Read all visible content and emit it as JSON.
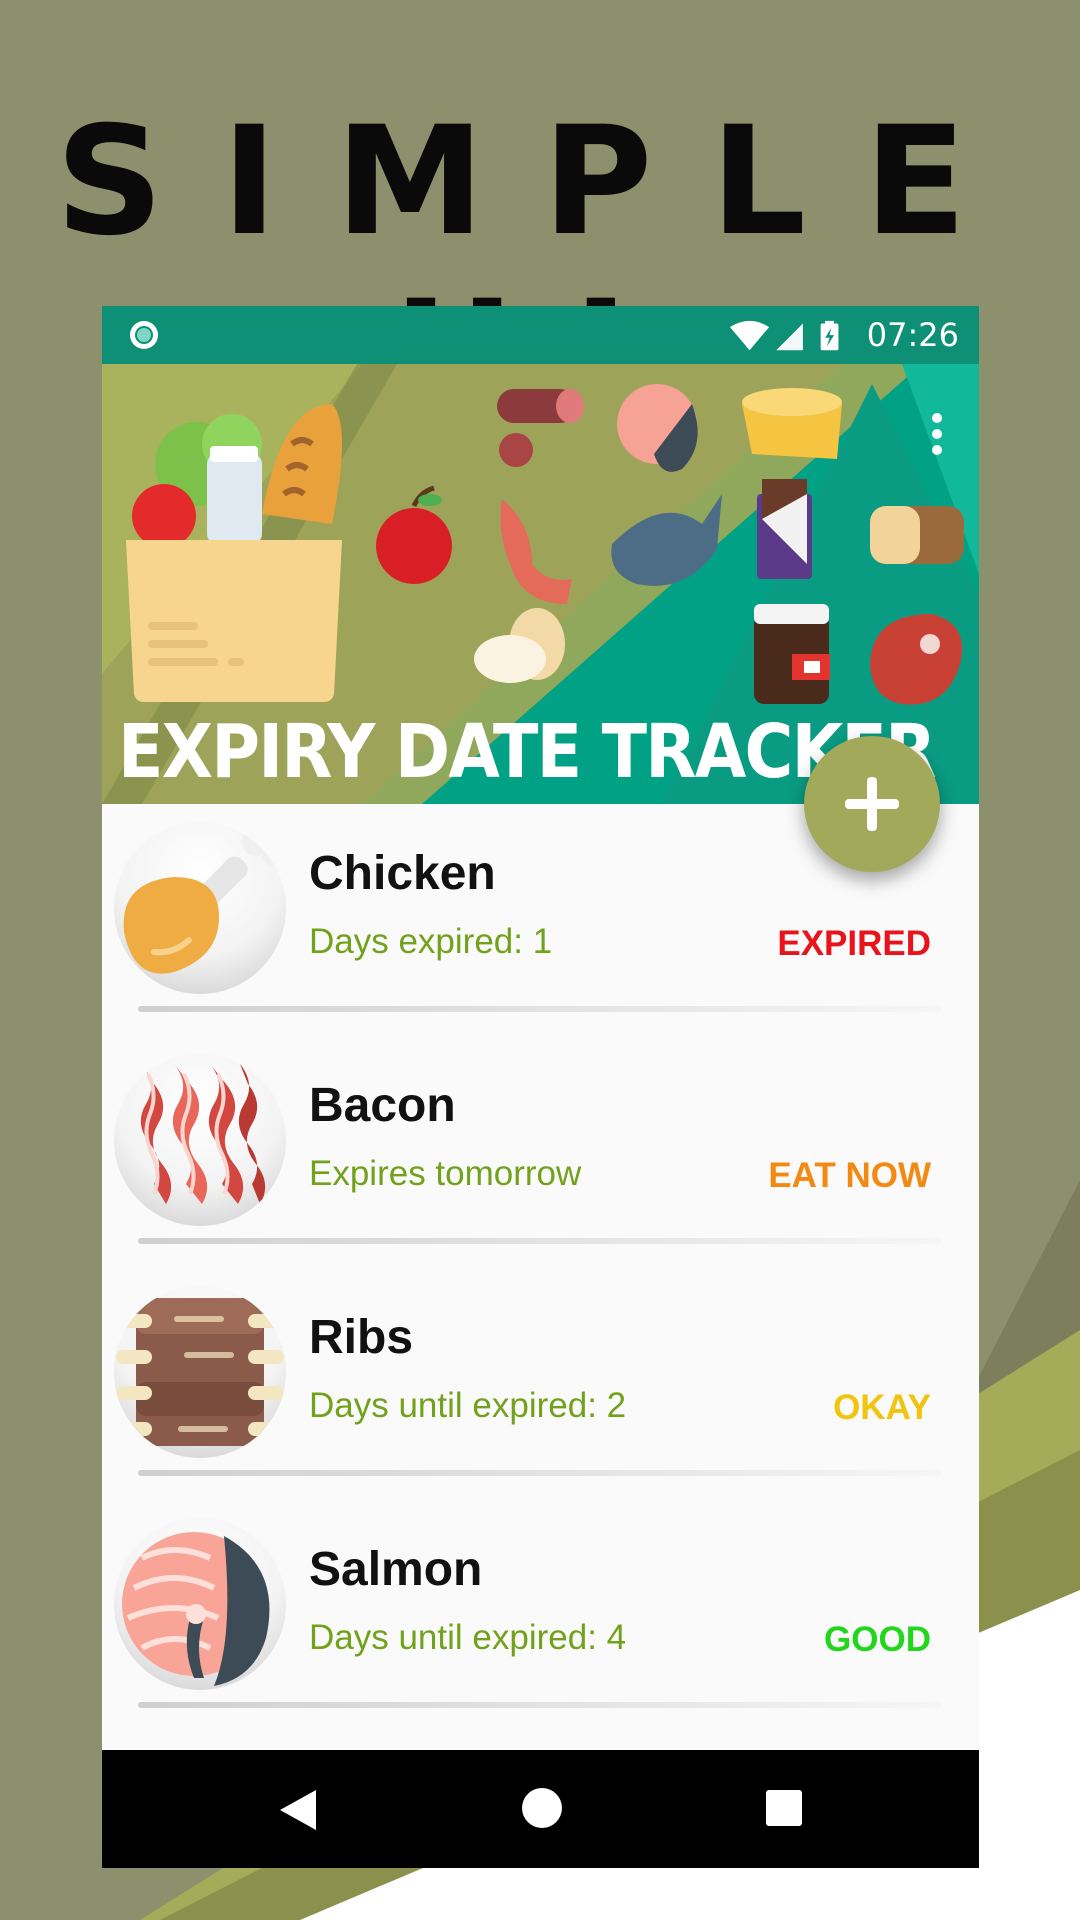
{
  "promo": {
    "title": "SIMPLE UI"
  },
  "status_bar": {
    "time": "07:26"
  },
  "header": {
    "app_title": "EXPIRY DATE TRACKER"
  },
  "colors": {
    "teal": "#0e9077",
    "olive": "#a2a95a",
    "sub_text": "#72a21c",
    "expired": "#e8141c",
    "eat_now": "#f28a12",
    "okay": "#f1c40f",
    "good": "#22d61b"
  },
  "items": [
    {
      "name": "Chicken",
      "subtitle": "Days expired: 1",
      "status": "EXPIRED",
      "status_color": "#e8141c",
      "icon": "chicken-leg-icon"
    },
    {
      "name": "Bacon",
      "subtitle": "Expires tomorrow",
      "status": "EAT NOW",
      "status_color": "#f28a12",
      "icon": "bacon-icon"
    },
    {
      "name": "Ribs",
      "subtitle": "Days until expired: 2",
      "status": "OKAY",
      "status_color": "#f1c40f",
      "icon": "ribs-icon"
    },
    {
      "name": "Salmon",
      "subtitle": "Days until expired: 4",
      "status": "GOOD",
      "status_color": "#22d61b",
      "icon": "salmon-icon"
    }
  ]
}
